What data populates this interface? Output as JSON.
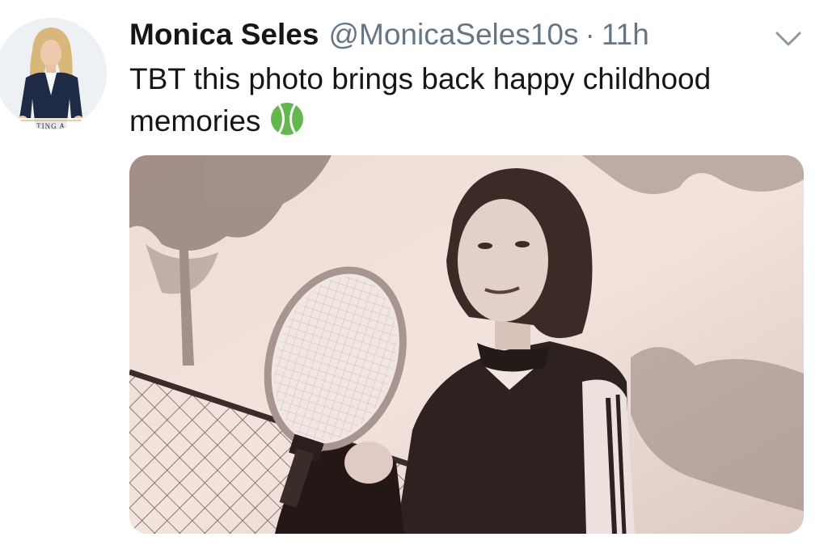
{
  "tweet": {
    "author": {
      "name": "Monica Seles",
      "handle": "@MonicaSeles10s",
      "avatar_caption": "TING A"
    },
    "separator": "·",
    "time": "11h",
    "text": {
      "line1": "TBT  this photo brings back happy childhood",
      "line2": "memories"
    },
    "emoji": "tennis-ball-icon",
    "menu_icon": "chevron-down-icon",
    "media": {
      "type": "photo",
      "description_colors": {
        "sepia_light": "#efe2dc",
        "sepia_dark": "#2c1f1c"
      }
    }
  },
  "colors": {
    "text_primary": "#14171a",
    "text_secondary": "#657786",
    "tennis_ball": "#5fb84f"
  }
}
